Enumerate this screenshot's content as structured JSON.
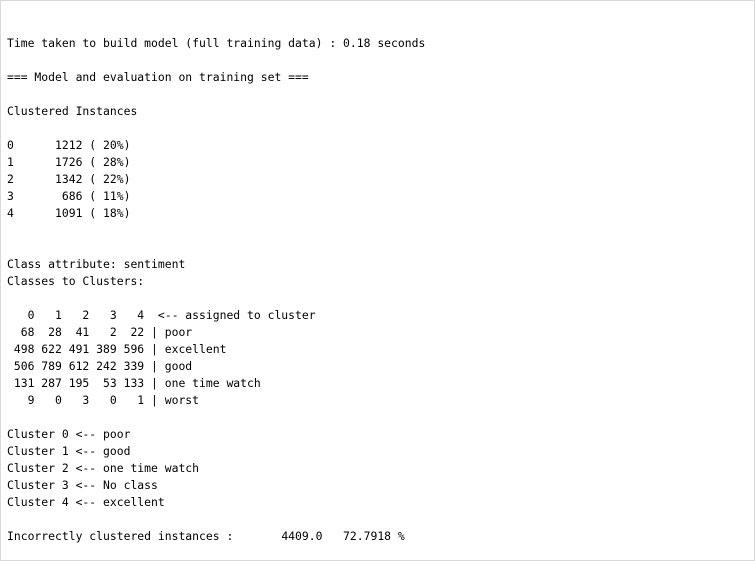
{
  "output_lines": [
    "Time taken to build model (full training data) : 0.18 seconds",
    "",
    "=== Model and evaluation on training set ===",
    "",
    "Clustered Instances",
    "",
    "0      1212 ( 20%)",
    "1      1726 ( 28%)",
    "2      1342 ( 22%)",
    "3       686 ( 11%)",
    "4      1091 ( 18%)",
    "",
    "",
    "Class attribute: sentiment",
    "Classes to Clusters:",
    "",
    "   0   1   2   3   4  <-- assigned to cluster",
    "  68  28  41   2  22 | poor",
    " 498 622 491 389 596 | excellent",
    " 506 789 612 242 339 | good",
    " 131 287 195  53 133 | one time watch",
    "   9   0   3   0   1 | worst",
    "",
    "Cluster 0 <-- poor",
    "Cluster 1 <-- good",
    "Cluster 2 <-- one time watch",
    "Cluster 3 <-- No class",
    "Cluster 4 <-- excellent",
    "",
    "Incorrectly clustered instances :\t4409.0\t 72.7918 %"
  ]
}
